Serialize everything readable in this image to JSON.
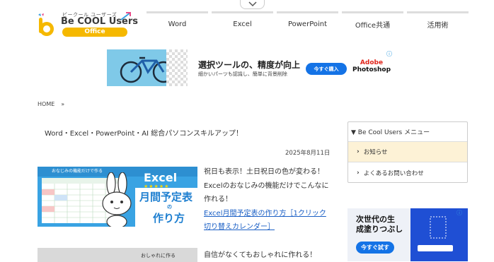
{
  "header": {
    "logo_kana": "ビークール ユーザーズ",
    "logo_title": "Be COOL Users",
    "logo_office": "Office"
  },
  "nav": {
    "items": [
      "Word",
      "Excel",
      "PowerPoint",
      "Office共通",
      "活用術"
    ]
  },
  "ad_banner": {
    "headline": "選択ツールの、精度が向上",
    "subtext": "細かいパーツも認識し、簡単に背景削除",
    "button": "今すぐ購入",
    "brand_top": "Adobe",
    "brand_bottom": "Photoshop"
  },
  "breadcrumb": {
    "home": "HOME",
    "sep": "»"
  },
  "intro": "Word・Excel・PowerPoint・AI 総合パソコンスキルアップ！",
  "date": "2025年8月11日",
  "post1": {
    "thumb_caption": "おなじみの機能だけで作る",
    "thumb_excel": "Excel",
    "thumb_stars": "★★★★★",
    "thumb_main": "月間予定表",
    "thumb_no": "の",
    "thumb_sub": "作り方",
    "excerpt": "祝日も表示！土日祝日の色が変わる！Excelのおなじみの機能だけでこんなに作れる！",
    "link": "Excel月間予定表の作り方［1クリック切り替えカレンダー］"
  },
  "post2": {
    "thumb_caption": "おしゃれに作る",
    "excerpt": "自信がなくてもおしゃれに作れる！"
  },
  "sidebar": {
    "menu_title": "▼ Be Cool Users メニュー",
    "items": [
      "お知らせ",
      "よくあるお問い合わせ"
    ]
  },
  "ad_side": {
    "headline_line1": "次世代の生",
    "headline_line2": "成塗りつぶし",
    "button": "今すぐ試す"
  },
  "colors": {
    "accent_yellow": "#f5b800",
    "link_blue": "#1a5fc5",
    "ad_blue": "#1473e6",
    "menu_active_bg": "#fdf2d6"
  }
}
